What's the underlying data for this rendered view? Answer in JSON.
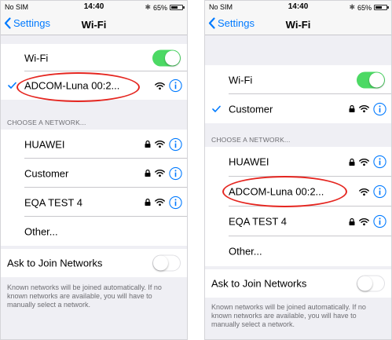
{
  "colors": {
    "accent": "#007aff",
    "toggle_on": "#4cd964",
    "annotation": "#e52620",
    "section_text": "#6d6d72"
  },
  "icons": {
    "lock": "lock-icon",
    "wifi": "wifi-icon",
    "info": "info-icon",
    "check": "checkmark-icon",
    "back": "chevron-left-icon",
    "bluetooth": "bluetooth-icon",
    "battery": "battery-icon"
  },
  "left": {
    "status": {
      "carrier": "No SIM",
      "time": "14:40",
      "battery": "65%",
      "battery_level": 0.65
    },
    "nav": {
      "back": "Settings",
      "title": "Wi-Fi"
    },
    "wifi": {
      "label": "Wi-Fi",
      "on": true
    },
    "connected": {
      "name": "ADCOM-Luna 00:2..."
    },
    "choose_header": "CHOOSE A NETWORK...",
    "networks": [
      {
        "name": "HUAWEI"
      },
      {
        "name": "Customer"
      },
      {
        "name": "EQA TEST 4"
      },
      {
        "name": "Other..."
      }
    ],
    "ask": {
      "label": "Ask to Join Networks",
      "on": false
    },
    "footer": "Known networks will be joined automatically. If no known networks are available, you will have to manually select a network."
  },
  "right": {
    "status": {
      "carrier": "No SIM",
      "time": "14:40",
      "battery": "65%",
      "battery_level": 0.65
    },
    "nav": {
      "back": "Settings",
      "title": "Wi-Fi"
    },
    "wifi": {
      "label": "Wi-Fi",
      "on": true
    },
    "connected": {
      "name": "Customer"
    },
    "choose_header": "CHOOSE A NETWORK...",
    "networks": [
      {
        "name": "HUAWEI"
      },
      {
        "name": "ADCOM-Luna 00:2..."
      },
      {
        "name": "EQA TEST 4"
      },
      {
        "name": "Other..."
      }
    ],
    "ask": {
      "label": "Ask to Join Networks",
      "on": false
    },
    "footer": "Known networks will be joined automatically. If no known networks are available, you will have to manually select a network."
  }
}
